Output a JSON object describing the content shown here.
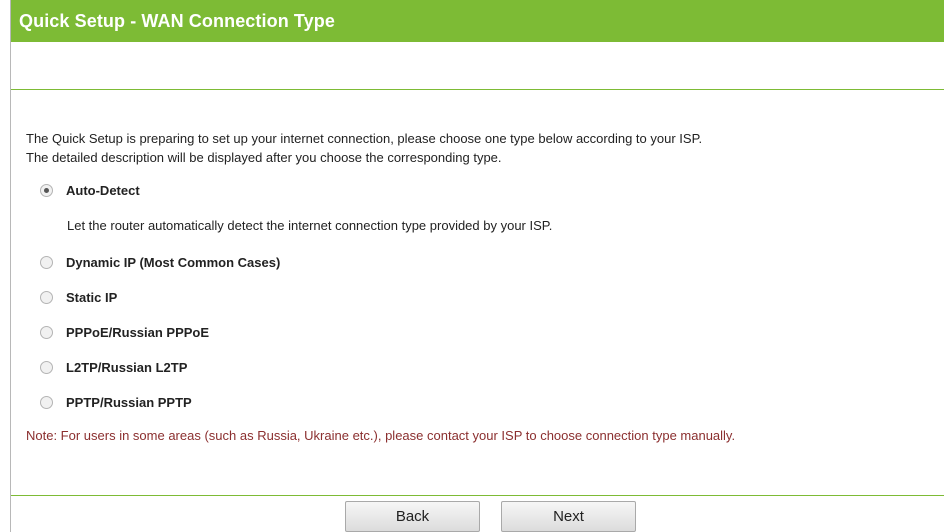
{
  "header": {
    "title": "Quick Setup - WAN Connection Type"
  },
  "intro": {
    "line1": "The Quick Setup is preparing to set up your internet connection, please choose one type below according to your ISP.",
    "line2": "The detailed description will be displayed after you choose the corresponding type."
  },
  "options": [
    {
      "label": "Auto-Detect",
      "selected": true
    },
    {
      "label": "Dynamic IP (Most Common Cases)",
      "selected": false
    },
    {
      "label": "Static IP",
      "selected": false
    },
    {
      "label": "PPPoE/Russian PPPoE",
      "selected": false
    },
    {
      "label": "L2TP/Russian L2TP",
      "selected": false
    },
    {
      "label": "PPTP/Russian PPTP",
      "selected": false
    }
  ],
  "auto_detect_description": "Let the router automatically detect the internet connection type provided by your ISP.",
  "note": "Note: For users in some areas (such as Russia, Ukraine etc.), please contact your ISP to choose connection type manually.",
  "buttons": {
    "back": "Back",
    "next": "Next"
  },
  "colors": {
    "title_bar": "#7dbb35",
    "note_text": "#8b2f2f"
  }
}
